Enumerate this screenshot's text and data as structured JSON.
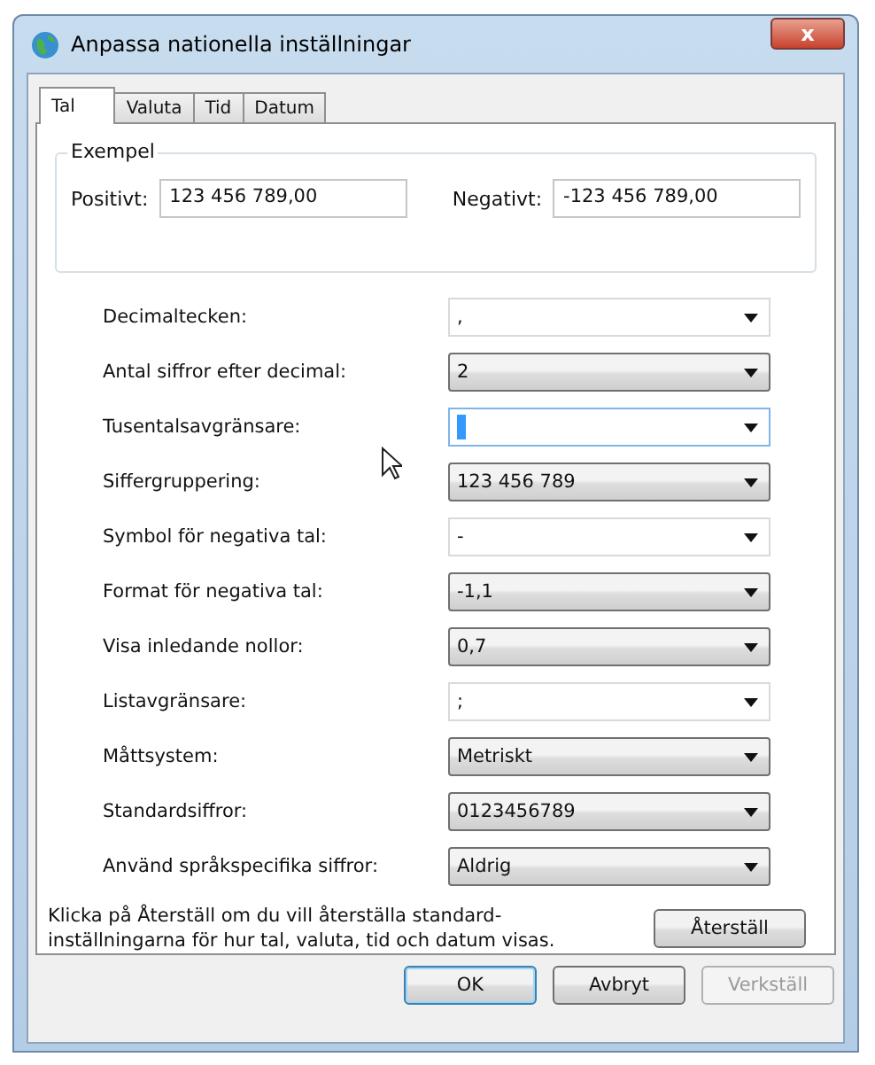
{
  "window": {
    "title": "Anpassa nationella inställningar",
    "close": "x"
  },
  "tabs": [
    {
      "label": "Tal",
      "selected": true
    },
    {
      "label": "Valuta",
      "selected": false
    },
    {
      "label": "Tid",
      "selected": false
    },
    {
      "label": "Datum",
      "selected": false
    }
  ],
  "example": {
    "title": "Exempel",
    "fields": [
      {
        "label": "Positivt:",
        "value": "123 456 789,00"
      },
      {
        "label": "Negativt:",
        "value": "-123 456 789,00"
      }
    ]
  },
  "settings": [
    {
      "label": "Decimaltecken:",
      "kind": "combo",
      "value": ",",
      "focused": false
    },
    {
      "label": "Antal siffror efter decimal:",
      "kind": "list",
      "value": "2",
      "focused": false
    },
    {
      "label": "Tusentalsavgränsare:",
      "kind": "combo",
      "focused": true
    },
    {
      "label": "Siffergruppering:",
      "kind": "list",
      "value": "123 456 789",
      "focused": false
    },
    {
      "label": "Symbol för negativa tal:",
      "kind": "combo",
      "value": "-",
      "focused": false
    },
    {
      "label": "Format för negativa tal:",
      "kind": "list",
      "value": "-1,1",
      "focused": false
    },
    {
      "label": "Visa inledande nollor:",
      "kind": "list",
      "value": "0,7",
      "focused": false
    },
    {
      "label": "Listavgränsare:",
      "kind": "combo",
      "value": ";",
      "focused": false
    },
    {
      "label": "Måttsystem:",
      "kind": "list",
      "value": "Metriskt",
      "focused": false
    },
    {
      "label": "Standardsiffror:",
      "kind": "list",
      "value": "0123456789",
      "focused": false
    },
    {
      "label": "Använd språkspecifika siffror:",
      "kind": "list",
      "value": "Aldrig",
      "focused": false
    }
  ],
  "reset": {
    "text": "Klicka på Återställ om du vill återställa standard-inställningarna för hur tal, valuta, tid och datum visas.",
    "button": "Återställ"
  },
  "buttons": [
    {
      "label": "OK",
      "default": true,
      "disabled": false
    },
    {
      "label": "Avbryt",
      "default": false,
      "disabled": false
    },
    {
      "label": "Verkställ",
      "default": false,
      "disabled": true
    }
  ]
}
